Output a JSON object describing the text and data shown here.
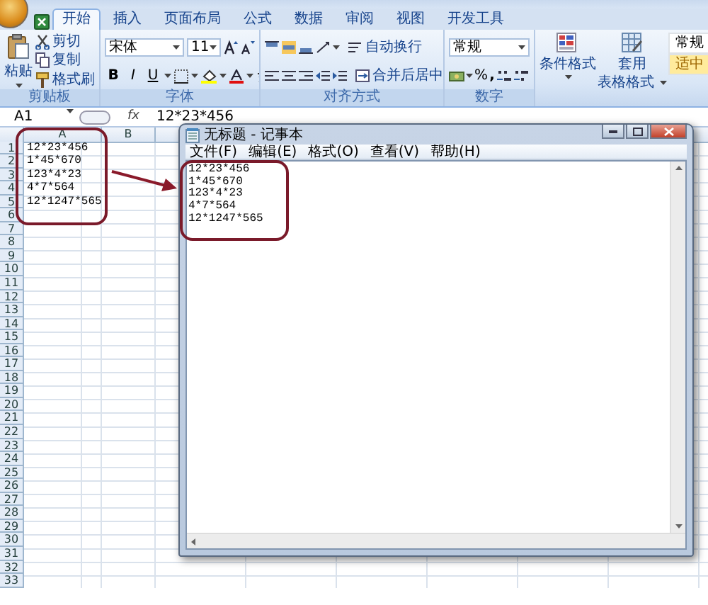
{
  "ribbon": {
    "tabs": [
      {
        "label": "开始",
        "selected": true
      },
      {
        "label": "插入",
        "selected": false
      },
      {
        "label": "页面布局",
        "selected": false
      },
      {
        "label": "公式",
        "selected": false
      },
      {
        "label": "数据",
        "selected": false
      },
      {
        "label": "审阅",
        "selected": false
      },
      {
        "label": "视图",
        "selected": false
      },
      {
        "label": "开发工具",
        "selected": false
      }
    ],
    "clipboard": {
      "label": "剪贴板",
      "paste": "粘贴",
      "commands": [
        "剪切",
        "复制",
        "格式刷"
      ]
    },
    "font": {
      "label": "字体",
      "font_name": "宋体",
      "font_size": "11",
      "styles": [
        "B",
        "I",
        "U"
      ]
    },
    "alignment": {
      "label": "对齐方式",
      "wrap_text": "自动换行",
      "merge_center": "合并后居中"
    },
    "number": {
      "label": "数字",
      "format": "常规",
      "percent": "%",
      "comma": ","
    },
    "styles": {
      "conditional_format": "条件格式",
      "table_format_top": "套用",
      "table_format_bottom": "表格格式",
      "gallery": [
        {
          "label": "常规",
          "color": "#ffffff"
        },
        {
          "label": "适中",
          "color": "#ffeb9c"
        }
      ]
    }
  },
  "formula_bar": {
    "name_box": "A1",
    "fx": "fx",
    "formula": "12*23*456"
  },
  "sheet": {
    "columns": [
      "A",
      "B"
    ],
    "rows": [
      {
        "header": "1",
        "a": "12*23*456"
      },
      {
        "header": "2",
        "a": "1*45*670"
      },
      {
        "header": "3",
        "a": "123*4*23"
      },
      {
        "header": "4",
        "a": "4*7*564"
      },
      {
        "header": "5",
        "a": "12*1247*565"
      },
      {
        "header": "6"
      },
      {
        "header": "7"
      },
      {
        "header": "8"
      },
      {
        "header": "9"
      },
      {
        "header": "10"
      },
      {
        "header": "11"
      },
      {
        "header": "12"
      },
      {
        "header": "13"
      },
      {
        "header": "14"
      },
      {
        "header": "15"
      },
      {
        "header": "16"
      },
      {
        "header": "17"
      },
      {
        "header": "18"
      },
      {
        "header": "19"
      },
      {
        "header": "20"
      },
      {
        "header": "21"
      },
      {
        "header": "22"
      },
      {
        "header": "23"
      },
      {
        "header": "24"
      },
      {
        "header": "25"
      },
      {
        "header": "26"
      },
      {
        "header": "27"
      },
      {
        "header": "28"
      },
      {
        "header": "29"
      },
      {
        "header": "30"
      },
      {
        "header": "31"
      },
      {
        "header": "32"
      },
      {
        "header": "33"
      }
    ]
  },
  "notepad": {
    "title": "无标题 - 记事本",
    "menu": [
      "文件(F)",
      "编辑(E)",
      "格式(O)",
      "查看(V)",
      "帮助(H)"
    ],
    "lines": [
      "12*23*456",
      "1*45*670",
      "123*4*23",
      "4*7*564",
      "12*1247*565"
    ]
  }
}
